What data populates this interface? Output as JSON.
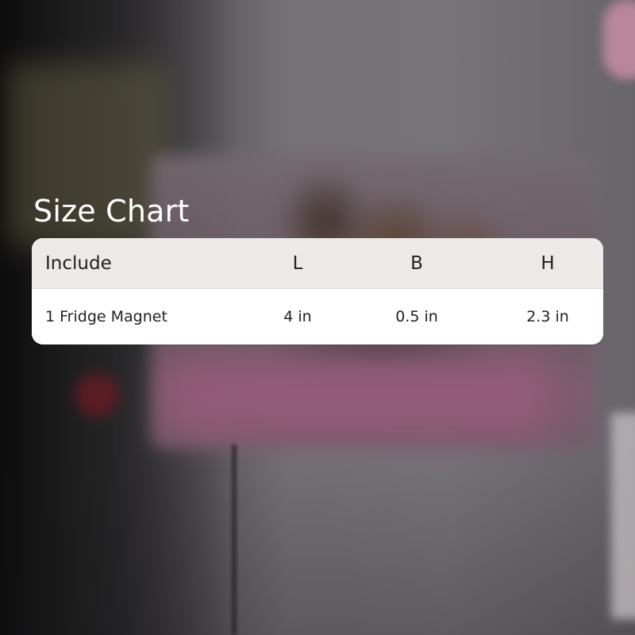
{
  "title": "Size Chart",
  "table": {
    "headers": [
      "Include",
      "L",
      "B",
      "H"
    ],
    "rows": [
      [
        "1 Fridge Magnet",
        "4 in",
        "0.5 in",
        "2.3 in"
      ]
    ]
  },
  "colors": {
    "title_text": "#ffffff",
    "header_bg": "#ebeae7",
    "row_bg": "#ffffff",
    "cell_text": "#222222"
  }
}
